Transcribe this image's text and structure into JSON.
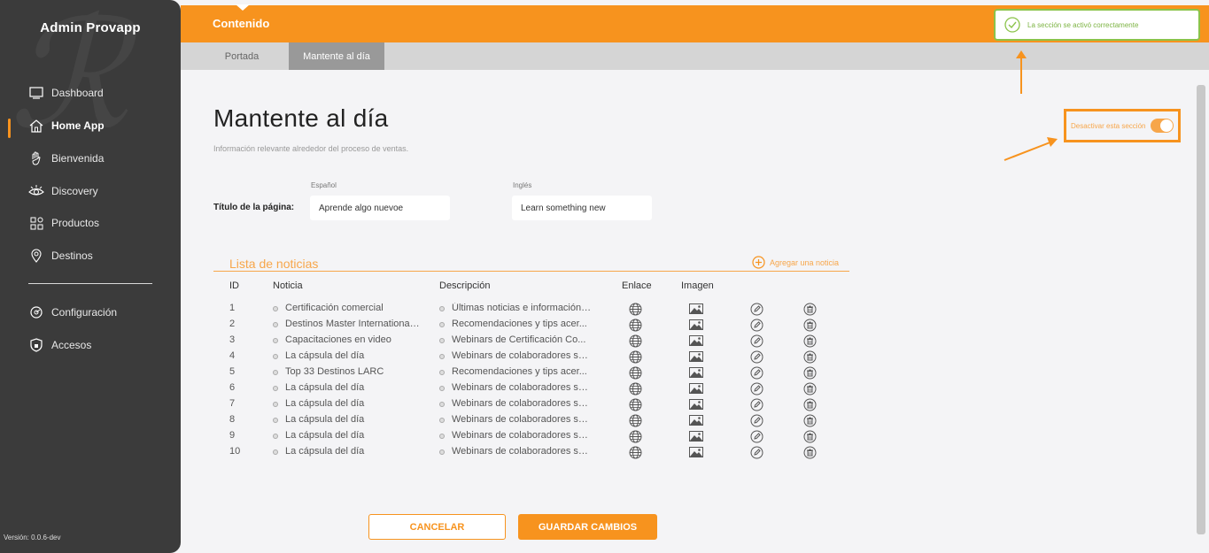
{
  "sidebar": {
    "brand": "Admin Provapp",
    "items": [
      {
        "label": "Dashboard",
        "icon": "monitor-icon"
      },
      {
        "label": "Home App",
        "icon": "home-icon"
      },
      {
        "label": "Bienvenida",
        "icon": "wave-hand-icon"
      },
      {
        "label": "Discovery",
        "icon": "eye-icon"
      },
      {
        "label": "Productos",
        "icon": "grid-icon"
      },
      {
        "label": "Destinos",
        "icon": "location-pin-icon"
      }
    ],
    "bottom_items": [
      {
        "label": "Configuración",
        "icon": "settings-icon"
      },
      {
        "label": "Accesos",
        "icon": "shield-icon"
      }
    ],
    "version": "Versión: 0.0.6-dev"
  },
  "header": {
    "title": "Contenido"
  },
  "toast": {
    "message": "La sección se activó correctamente"
  },
  "tabs": [
    {
      "label": "Portada",
      "active": false
    },
    {
      "label": "Mantente al día",
      "active": true
    }
  ],
  "page": {
    "title": "Mantente al día",
    "subtitle": "Información relevante alrededor del proceso de ventas.",
    "toggle_label": "Desactivar esta sección",
    "toggle_on": true
  },
  "form": {
    "field_label": "Título de la página:",
    "lang_es": "Español",
    "lang_en": "Inglés",
    "value_es": "Aprende algo nuevoe",
    "value_en": "Learn something new"
  },
  "news": {
    "list_title": "Lista de noticias",
    "add_label": "Agregar una noticia",
    "columns": {
      "id": "ID",
      "news": "Noticia",
      "desc": "Descripción",
      "link": "Enlace",
      "image": "Imagen"
    },
    "rows": [
      {
        "id": "1",
        "news": "Certificación comercial",
        "desc": "Últimas noticias e información ..."
      },
      {
        "id": "2",
        "news": "Destinos Master International ...",
        "desc": "Recomendaciones y tips acer..."
      },
      {
        "id": "3",
        "news": "Capacitaciones en video",
        "desc": "Webinars de Certificación Co..."
      },
      {
        "id": "4",
        "news": "La cápsula del día",
        "desc": "Webinars de colaboradores so..."
      },
      {
        "id": "5",
        "news": "Top 33 Destinos LARC",
        "desc": "Recomendaciones y tips acer..."
      },
      {
        "id": "6",
        "news": "La cápsula del día",
        "desc": "Webinars de colaboradores so..."
      },
      {
        "id": "7",
        "news": "La cápsula del día",
        "desc": "Webinars de colaboradores so..."
      },
      {
        "id": "8",
        "news": "La cápsula del día",
        "desc": "Webinars de colaboradores so..."
      },
      {
        "id": "9",
        "news": "La cápsula del día",
        "desc": "Webinars de colaboradores so..."
      },
      {
        "id": "10",
        "news": "La cápsula del día",
        "desc": "Webinars de colaboradores so..."
      }
    ]
  },
  "actions": {
    "cancel": "CANCELAR",
    "save": "GUARDAR CAMBIOS"
  },
  "colors": {
    "accent": "#f7931e",
    "sidebar": "#3b3b3b",
    "success": "#8bc34a"
  }
}
